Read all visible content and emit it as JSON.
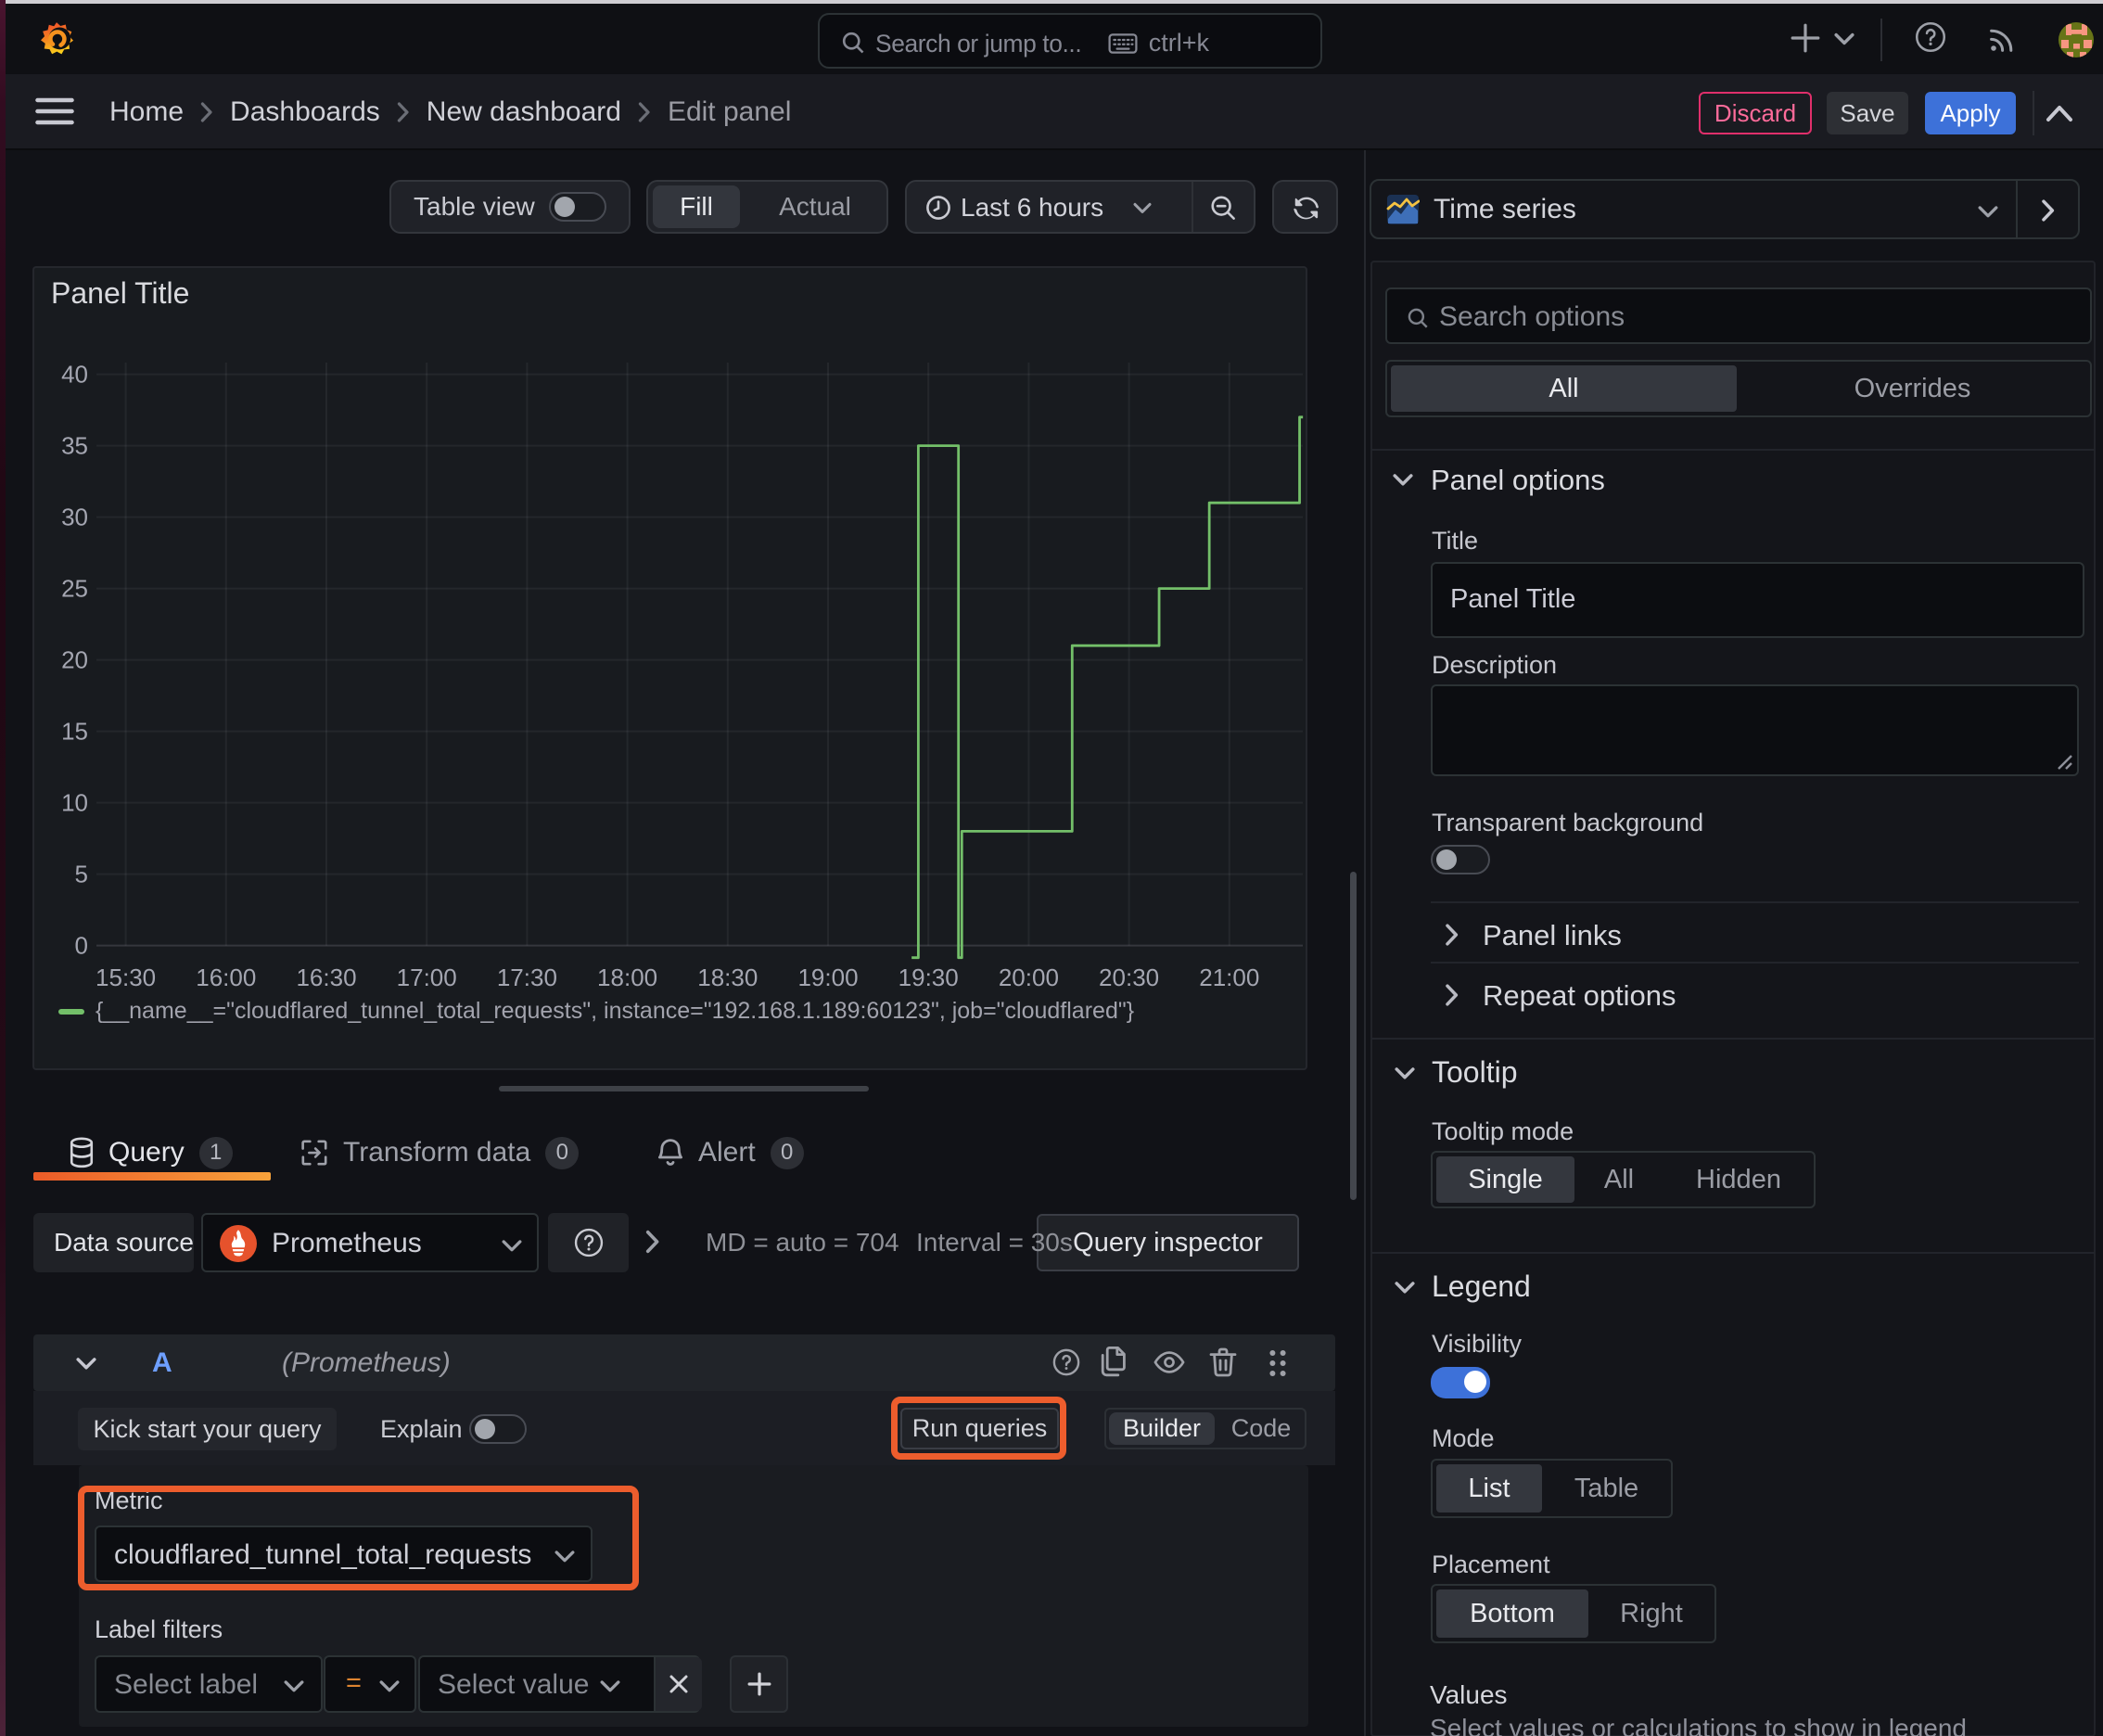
{
  "topbar": {
    "search_placeholder": "Search or jump to...",
    "shortcut": "ctrl+k"
  },
  "breadcrumb": {
    "items": [
      {
        "label": "Home"
      },
      {
        "label": "Dashboards"
      },
      {
        "label": "New dashboard"
      },
      {
        "label": "Edit panel"
      }
    ]
  },
  "actions": {
    "discard": "Discard",
    "save": "Save",
    "apply": "Apply"
  },
  "toolbar": {
    "table_view": "Table view",
    "fill": "Fill",
    "actual": "Actual",
    "time_range": "Last 6 hours"
  },
  "panel": {
    "title": "Panel Title"
  },
  "chart_data": {
    "type": "line",
    "title": "Panel Title",
    "interpolation": "step-after",
    "x_ticks": [
      "15:30",
      "16:00",
      "16:30",
      "17:00",
      "17:30",
      "18:00",
      "18:30",
      "19:00",
      "19:30",
      "20:00",
      "20:30",
      "21:00"
    ],
    "y_ticks": [
      0,
      5,
      10,
      15,
      20,
      25,
      30,
      35,
      40
    ],
    "ylim": [
      -0.85,
      40.8
    ],
    "grid": true,
    "legend_position": "bottom",
    "series": [
      {
        "name": "{__name__=\"cloudflared_tunnel_total_requests\", instance=\"192.168.1.189:60123\", job=\"cloudflared\"}",
        "color": "#73bf69",
        "points": [
          [
            "19:25",
            0
          ],
          [
            "19:27",
            35
          ],
          [
            "19:39",
            0
          ],
          [
            "19:40",
            8
          ],
          [
            "20:13",
            21
          ],
          [
            "20:39",
            25
          ],
          [
            "20:54",
            31
          ],
          [
            "21:21",
            37
          ],
          [
            "21:22",
            37
          ]
        ]
      }
    ]
  },
  "tabs": {
    "query": {
      "label": "Query",
      "count": "1"
    },
    "transform": {
      "label": "Transform data",
      "count": "0"
    },
    "alert": {
      "label": "Alert",
      "count": "0"
    }
  },
  "datasource_row": {
    "label": "Data source",
    "name": "Prometheus",
    "md": "MD = auto = 704",
    "interval": "Interval = 30s",
    "inspector": "Query inspector"
  },
  "query_row": {
    "ref": "A",
    "ds": "(Prometheus)",
    "kick": "Kick start your query",
    "explain": "Explain",
    "run": "Run queries",
    "builder": "Builder",
    "code": "Code",
    "metric_label": "Metric",
    "metric_value": "cloudflared_tunnel_total_requests",
    "filters_label": "Label filters",
    "select_label": "Select label",
    "op": "=",
    "select_value": "Select value"
  },
  "options": {
    "viz": "Time series",
    "search_placeholder": "Search options",
    "tab_all": "All",
    "tab_overrides": "Overrides",
    "panel_options": {
      "title": "Panel options",
      "title_label": "Title",
      "title_value": "Panel Title",
      "desc_label": "Description",
      "transparent": "Transparent background",
      "links": "Panel links",
      "repeat": "Repeat options"
    },
    "tooltip": {
      "title": "Tooltip",
      "mode_label": "Tooltip mode",
      "single": "Single",
      "all": "All",
      "hidden": "Hidden"
    },
    "legend": {
      "title": "Legend",
      "visibility": "Visibility",
      "mode_label": "Mode",
      "list": "List",
      "table": "Table",
      "placement_label": "Placement",
      "bottom": "Bottom",
      "right": "Right",
      "values_label": "Values",
      "values_help": "Select values or calculations to show in legend"
    }
  },
  "colors": {
    "accent_blue": "#3d71d9",
    "destructive": "#e02f6b",
    "series_green": "#73bf69",
    "annotation_orange": "#ed5d2d",
    "tab_underline": "#ec5b28"
  }
}
